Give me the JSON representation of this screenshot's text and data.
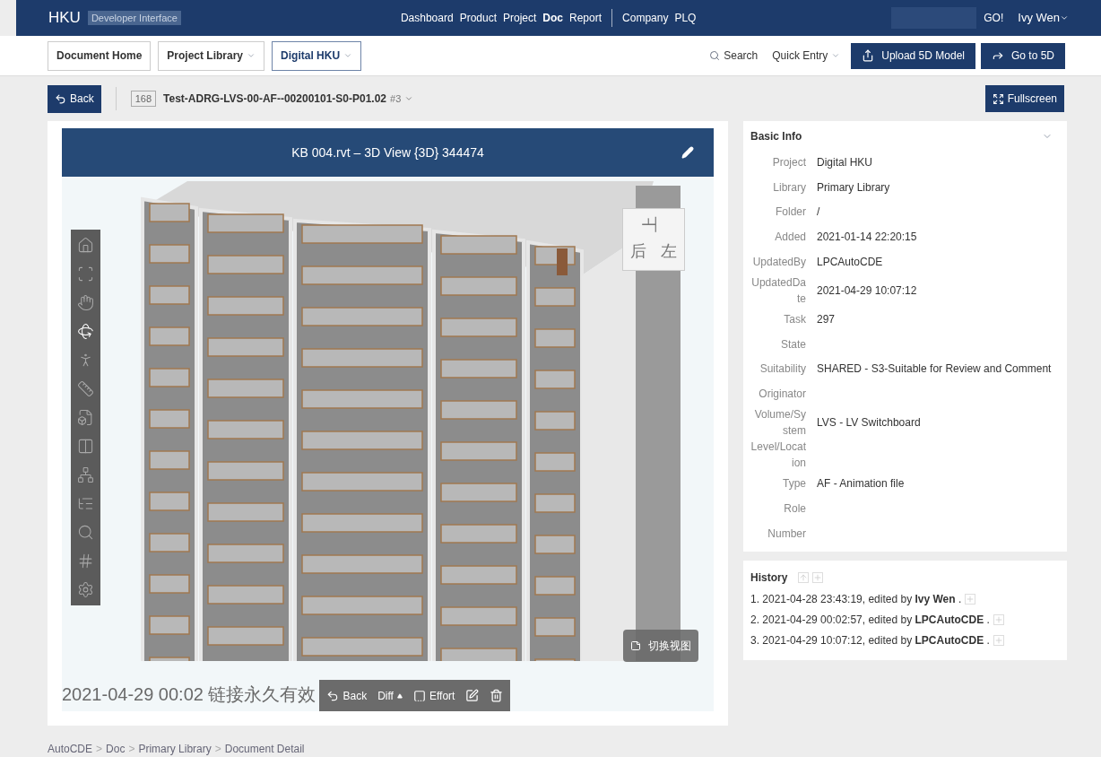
{
  "topbar": {
    "logo": "HKU",
    "subtitle": "Developer Interface",
    "nav": [
      {
        "label": "Dashboard",
        "selected": false
      },
      {
        "label": "Product",
        "selected": false
      },
      {
        "label": "Project",
        "selected": false
      },
      {
        "label": "Doc",
        "selected": true
      },
      {
        "label": "Report",
        "selected": false
      }
    ],
    "nav2": [
      {
        "label": "Company",
        "selected": false
      },
      {
        "label": "PLQ",
        "selected": false
      }
    ],
    "go": "GO!",
    "user": "Ivy Wen"
  },
  "breadcrumb_tabs": [
    {
      "label": "Document Home",
      "dropdown": false,
      "selected": false
    },
    {
      "label": "Project Library",
      "dropdown": true,
      "selected": false
    },
    {
      "label": "Digital HKU",
      "dropdown": true,
      "selected": true
    }
  ],
  "actions": {
    "search": "Search",
    "quick_entry": "Quick Entry",
    "upload": "Upload 5D Model",
    "goto": "Go to 5D"
  },
  "doc_bar": {
    "back": "Back",
    "id": "168",
    "name": "Test-ADRG-LVS-00-AF--00200101-S0-P01.02",
    "version": "#3",
    "fullscreen": "Fullscreen"
  },
  "viewer": {
    "title": "KB 004.rvt – 3D View {3D} 344474",
    "cube_faces": [
      "上",
      "后",
      "左"
    ],
    "tools": [
      {
        "kind": "home",
        "selected": false
      },
      {
        "kind": "fit",
        "selected": false
      },
      {
        "kind": "pan",
        "selected": false
      },
      {
        "kind": "orbit",
        "selected": true
      },
      {
        "kind": "walk",
        "selected": false
      },
      {
        "kind": "measure",
        "selected": false
      },
      {
        "kind": "model",
        "selected": false
      },
      {
        "kind": "section",
        "selected": false
      },
      {
        "kind": "tree",
        "selected": false
      },
      {
        "kind": "list",
        "selected": false
      },
      {
        "kind": "search",
        "selected": false
      },
      {
        "kind": "grid",
        "selected": false
      },
      {
        "kind": "settings",
        "selected": false
      }
    ],
    "switch_view": "切换视图",
    "stamp": "2021-04-29 00:02 链接永久有效",
    "bottom": {
      "back": "Back",
      "diff": "Diff",
      "effort": "Effort"
    }
  },
  "basic_info": {
    "title": "Basic Info",
    "fields": [
      {
        "label": "Project",
        "value": "Digital HKU"
      },
      {
        "label": "Library",
        "value": "Primary Library"
      },
      {
        "label": "Folder",
        "value": "/"
      },
      {
        "label": "Added",
        "value": "2021-01-14 22:20:15"
      },
      {
        "label": "UpdatedBy",
        "value": "LPCAutoCDE"
      },
      {
        "label": "UpdatedDate",
        "value": "2021-04-29 10:07:12"
      },
      {
        "label": "Task",
        "value": "297"
      },
      {
        "label": "State"
      },
      {
        "label": "Suitability",
        "value": "SHARED - S3-Suitable for Review and Comment"
      },
      {
        "label": "Originator"
      },
      {
        "label": "Volume/System",
        "value": "LVS - LV Switchboard"
      },
      {
        "label": "Level/Location"
      },
      {
        "label": "Type",
        "value": "AF - Animation file"
      },
      {
        "label": "Role"
      },
      {
        "label": "Number"
      }
    ]
  },
  "history": {
    "title": "History",
    "entries": [
      {
        "text": "1. 2021-04-28 23:43:19, edited by **Ivy Wen** ."
      },
      {
        "text": "2. 2021-04-29 00:02:57, edited by **LPCAutoCDE** ."
      },
      {
        "text": "3. 2021-04-29 10:07:12, edited by **LPCAutoCDE** ."
      }
    ]
  },
  "footer": {
    "separator": ">",
    "items": [
      "AutoCDE",
      "Doc",
      "Primary Library",
      "Document Detail"
    ]
  }
}
